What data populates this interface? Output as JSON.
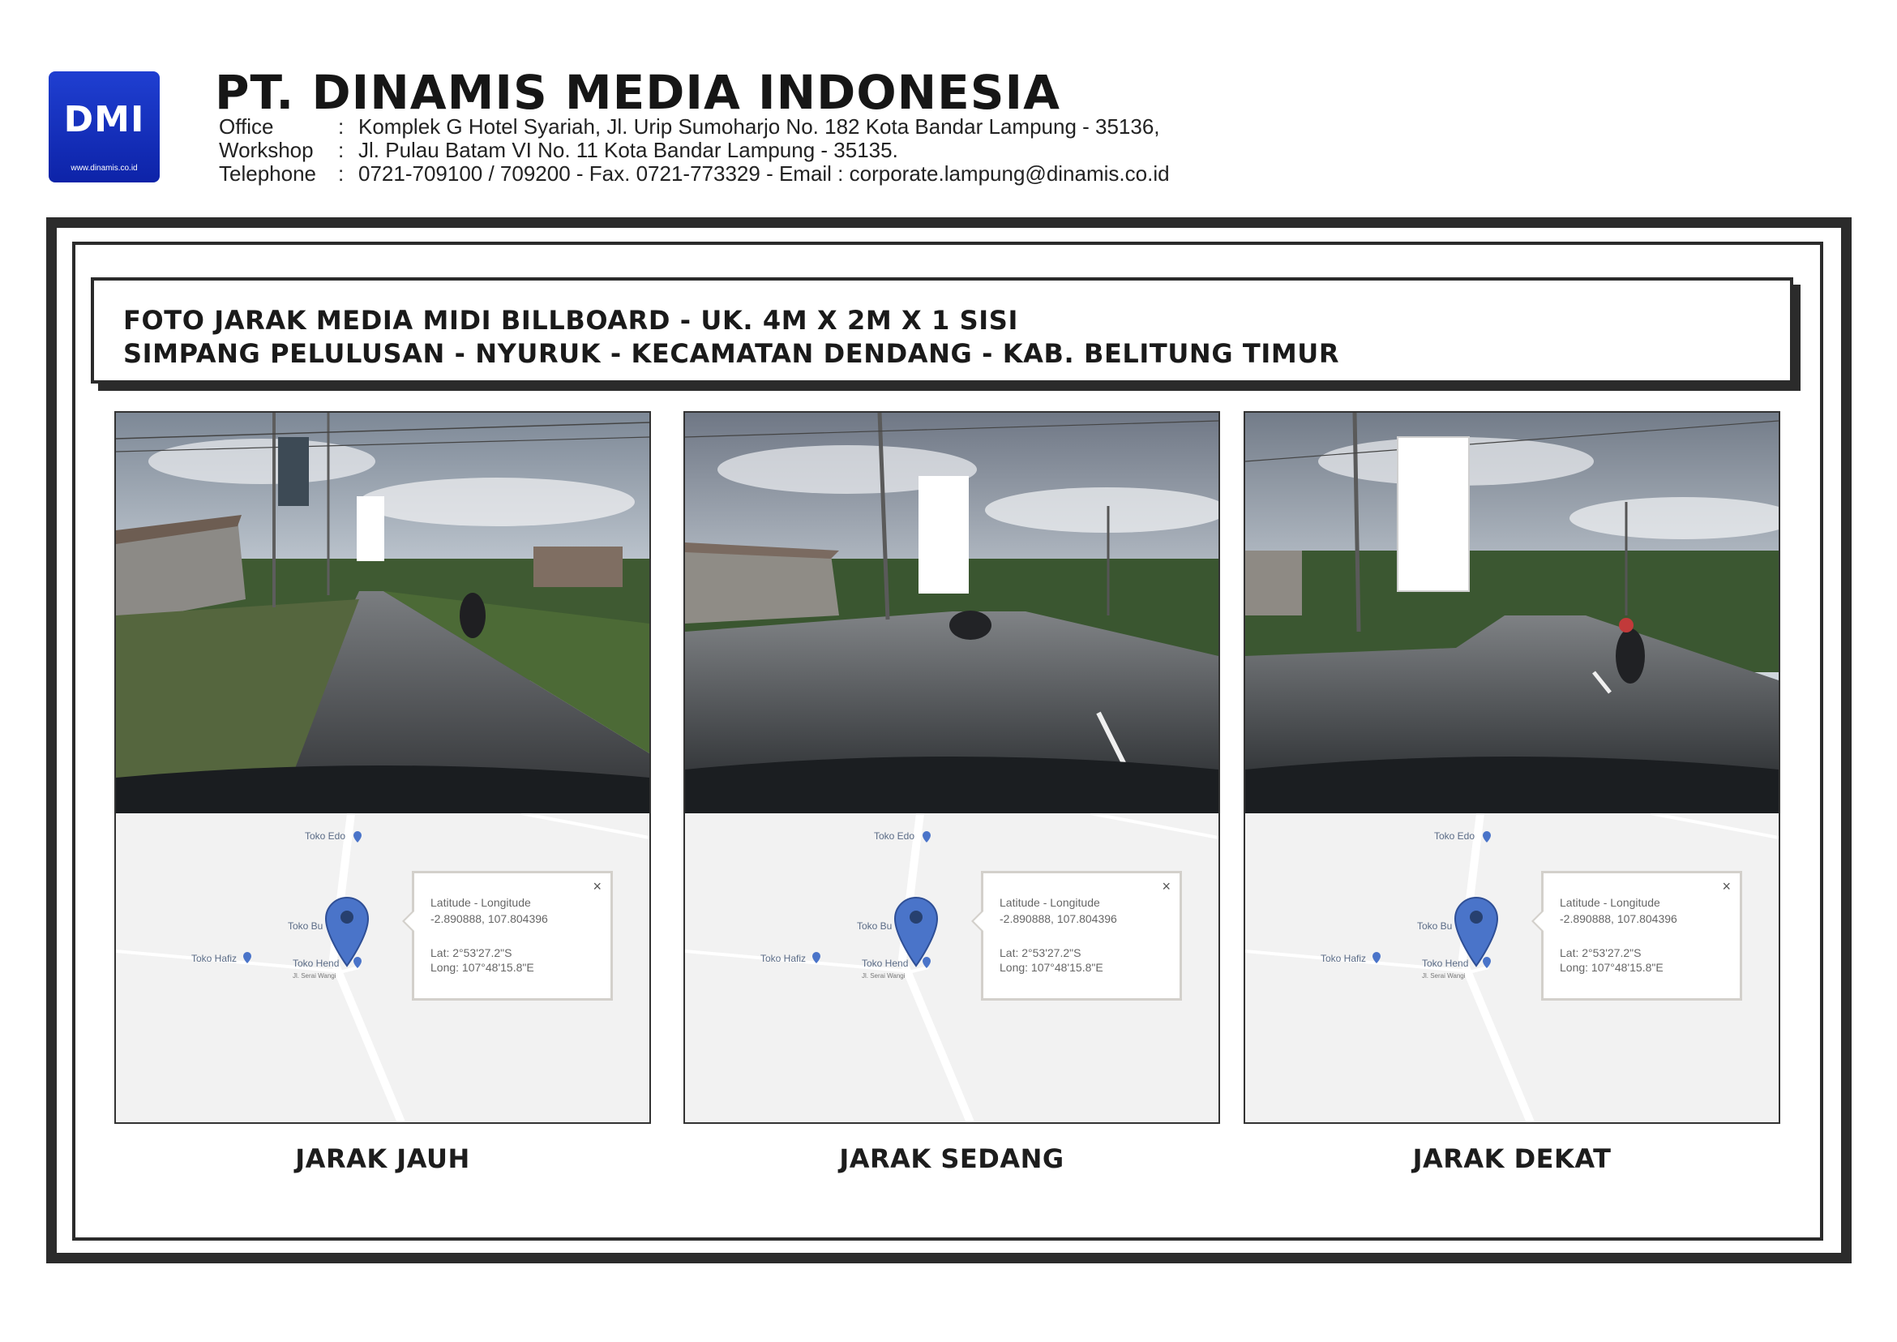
{
  "header": {
    "logo_text": "DMI",
    "logo_url": "www.dinamis.co.id",
    "company_name": "PT. DINAMIS MEDIA INDONESIA",
    "contacts": [
      {
        "label": "Office",
        "value": "Komplek G Hotel Syariah, Jl. Urip  Sumoharjo No. 182 Kota Bandar Lampung - 35136,"
      },
      {
        "label": "Workshop",
        "value": "Jl. Pulau Batam  VI  No. 11 Kota Bandar Lampung - 35135."
      },
      {
        "label": "Telephone",
        "value": "0721-709100 / 709200 - Fax. 0721-773329 - Email : corporate.lampung@dinamis.co.id"
      }
    ],
    "separator": ":",
    "brand_color": "#1230c4"
  },
  "title": {
    "line1": "FOTO JARAK MEDIA MIDI BILLBOARD - UK. 4M X 2M X 1 SISI",
    "line2": "SIMPANG PELULUSAN - NYURUK - KECAMATAN DENDANG - KAB. BELITUNG TIMUR"
  },
  "map_popup": {
    "close": "×",
    "title": "Latitude - Longitude",
    "coords": "-2.890888, 107.804396",
    "lat": "Lat: 2°53'27.2\"S",
    "long": "Long: 107°48'15.8\"E"
  },
  "map_places": {
    "top": "Toko Edo",
    "middle": "Toko Bu",
    "left": "Toko Hafiz",
    "bottom": "Toko Hend",
    "street": "Jl. Serai Wangi"
  },
  "panels": [
    {
      "caption": "JARAK JAUH"
    },
    {
      "caption": "JARAK SEDANG"
    },
    {
      "caption": "JARAK DEKAT"
    }
  ],
  "colors": {
    "frame": "#2b2b2b",
    "map_pin": "#4a74c9",
    "map_background": "#f2f2f2"
  }
}
